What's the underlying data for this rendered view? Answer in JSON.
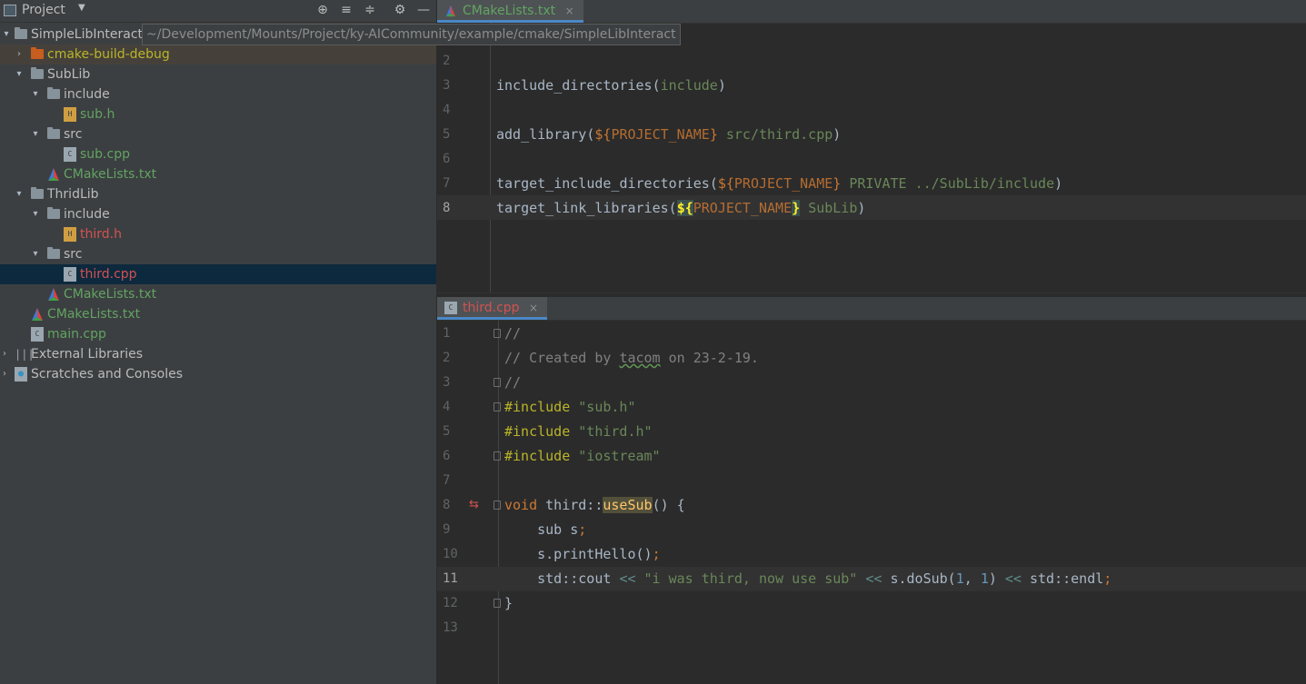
{
  "sidebar": {
    "title": "Project",
    "header_icons": [
      "target-icon",
      "expand-all-icon",
      "collapse-all-icon",
      "gear-icon",
      "minimize-icon"
    ],
    "tooltip_path": "~/Development/Mounts/Project/ky-AICommunity/example/cmake/SimpleLibInteract",
    "tree": [
      {
        "label": "SimpleLibInteract",
        "color": "#bbbbbb",
        "type": "folder"
      },
      {
        "label": "cmake-build-debug",
        "color": "#bbb529",
        "type": "folder-orange"
      },
      {
        "label": "SubLib",
        "color": "#bbbbbb",
        "type": "folder"
      },
      {
        "label": "include",
        "color": "#bbbbbb",
        "type": "folder"
      },
      {
        "label": "sub.h",
        "color": "#62a362",
        "type": "header-file"
      },
      {
        "label": "src",
        "color": "#bbbbbb",
        "type": "folder"
      },
      {
        "label": "sub.cpp",
        "color": "#62a362",
        "type": "cpp-file"
      },
      {
        "label": "CMakeLists.txt",
        "color": "#62a362",
        "type": "cmake-file"
      },
      {
        "label": "ThridLib",
        "color": "#bbbbbb",
        "type": "folder"
      },
      {
        "label": "include",
        "color": "#bbbbbb",
        "type": "folder"
      },
      {
        "label": "third.h",
        "color": "#d25252",
        "type": "header-file"
      },
      {
        "label": "src",
        "color": "#bbbbbb",
        "type": "folder"
      },
      {
        "label": "third.cpp",
        "color": "#d25252",
        "type": "cpp-file"
      },
      {
        "label": "CMakeLists.txt",
        "color": "#62a362",
        "type": "cmake-file"
      },
      {
        "label": "CMakeLists.txt",
        "color": "#62a362",
        "type": "cmake-file"
      },
      {
        "label": "main.cpp",
        "color": "#62a362",
        "type": "cpp-file"
      },
      {
        "label": "External Libraries",
        "color": "#bbbbbb",
        "type": "libraries"
      },
      {
        "label": "Scratches and Consoles",
        "color": "#bbbbbb",
        "type": "scratches"
      }
    ]
  },
  "editor_top": {
    "tab_label": "CMakeLists.txt",
    "tab_color": "#62a362",
    "tab_close": "×",
    "line_numbers": [
      "2",
      "3",
      "4",
      "5",
      "6",
      "7",
      "8"
    ]
  },
  "editor_bottom": {
    "tab_label": "third.cpp",
    "tab_color": "#d25252",
    "tab_close": "×",
    "line_numbers": [
      "1",
      "2",
      "3",
      "4",
      "5",
      "6",
      "7",
      "8",
      "9",
      "10",
      "11",
      "12",
      "13"
    ]
  },
  "colors": {
    "sidebar_bg": "#3c3f41",
    "editor_bg": "#2b2b2b",
    "selection": "#0d293e",
    "modified_green": "#62a362",
    "error_red": "#d25252"
  }
}
